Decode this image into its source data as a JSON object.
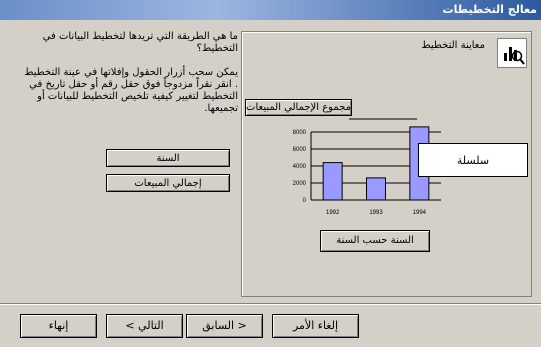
{
  "window": {
    "title": "معالج التخطيطات"
  },
  "left_panel": {
    "question": "ما هي الطريقة التي تريدها لتخطيط البيانات في التخطيط؟",
    "help": "يمكن سحب أزرار الحقول وإفلاتها في عينة التخطيط . انقر نقراً مزدوجاً فوق حقل رقم أو حقل تاريخ  في التخطيط لتغيير كيفية تلخيص التخطيط  للبيانات أو تجميعها.",
    "fields": [
      "السنة",
      "إجمالي المبيعات"
    ]
  },
  "preview": {
    "label": "معاينة التخطيط",
    "icon": "chart-preview-icon",
    "sum_field": "مجموع الإجمالي المبيعات",
    "series_box": "سلسلة",
    "axis_field": "السنة حسب السنة"
  },
  "chart_data": {
    "type": "bar",
    "categories": [
      "1992",
      "1993",
      "1994"
    ],
    "values": [
      4400,
      2600,
      8600
    ],
    "yticks": [
      "0",
      "2000",
      "4000",
      "6000",
      "8000"
    ],
    "ylim": [
      0,
      8000
    ],
    "bar_color": "#9999ff"
  },
  "buttons": {
    "cancel": "إلغاء الأمر",
    "back": "< السابق",
    "next": "التالي >",
    "finish": "إنهاء"
  }
}
